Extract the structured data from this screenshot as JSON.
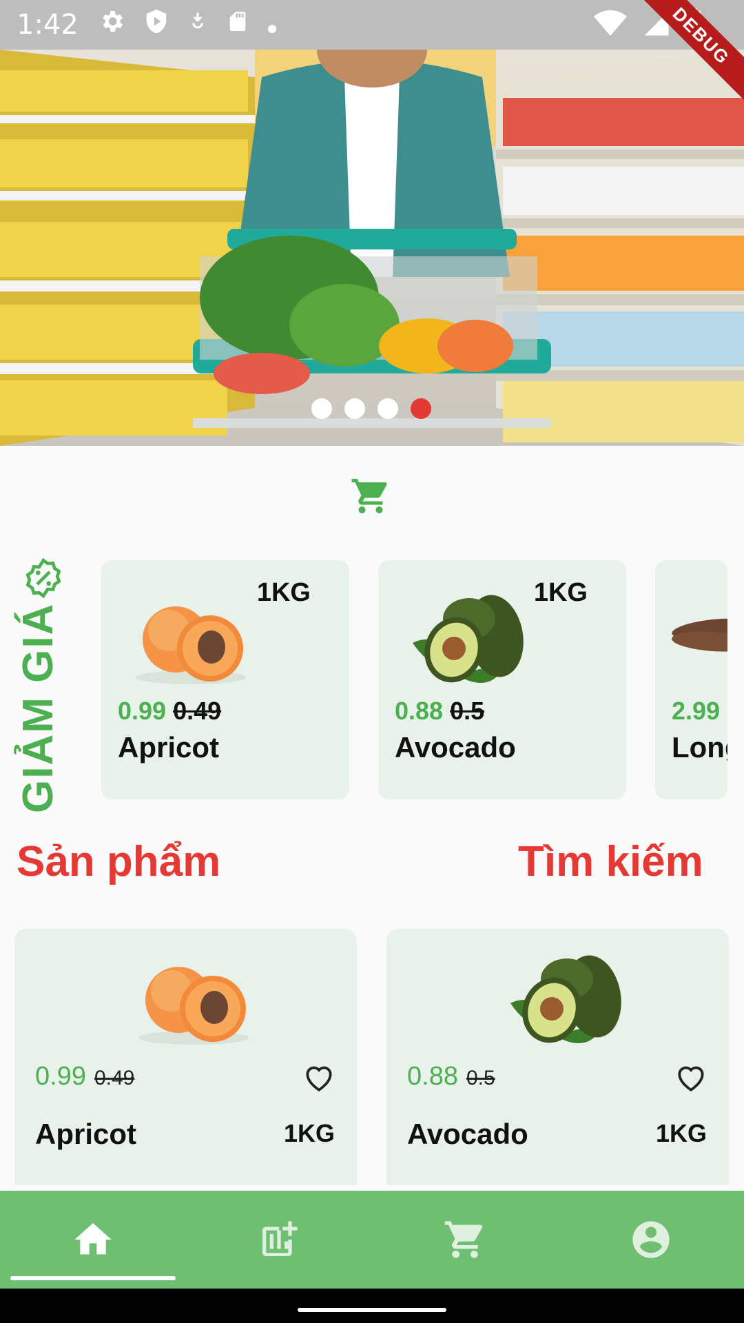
{
  "status_bar": {
    "time": "1:42",
    "debug_label": "DEBUG"
  },
  "banner": {
    "slide_count": 4,
    "active_slide": 4
  },
  "discount": {
    "title": "GIẢM GIÁ",
    "items": [
      {
        "name": "Apricot",
        "price": "0.99",
        "old_price": "0.49",
        "weight": "1KG",
        "image": "apricot"
      },
      {
        "name": "Avocado",
        "price": "0.88",
        "old_price": "0.5",
        "weight": "1KG",
        "image": "avocado"
      },
      {
        "name": "Long",
        "price": "2.99",
        "old_price": "",
        "weight": "",
        "image": "longan"
      }
    ]
  },
  "sections": {
    "products_label": "Sản phẩm",
    "search_label": "Tìm kiếm"
  },
  "products": [
    {
      "name": "Apricot",
      "price": "0.99",
      "old_price": "0.49",
      "weight": "1KG",
      "image": "apricot"
    },
    {
      "name": "Avocado",
      "price": "0.88",
      "old_price": "0.5",
      "weight": "1KG",
      "image": "avocado"
    }
  ],
  "bottom_nav": {
    "items": [
      {
        "icon": "home-icon",
        "active": true
      },
      {
        "icon": "chart-add-icon",
        "active": false
      },
      {
        "icon": "cart-icon",
        "active": false
      },
      {
        "icon": "account-icon",
        "active": false
      }
    ]
  },
  "colors": {
    "accent_green": "#4caf50",
    "nav_green": "#6fbf73",
    "red": "#e53935",
    "card_bg": "#e8f2ea"
  }
}
